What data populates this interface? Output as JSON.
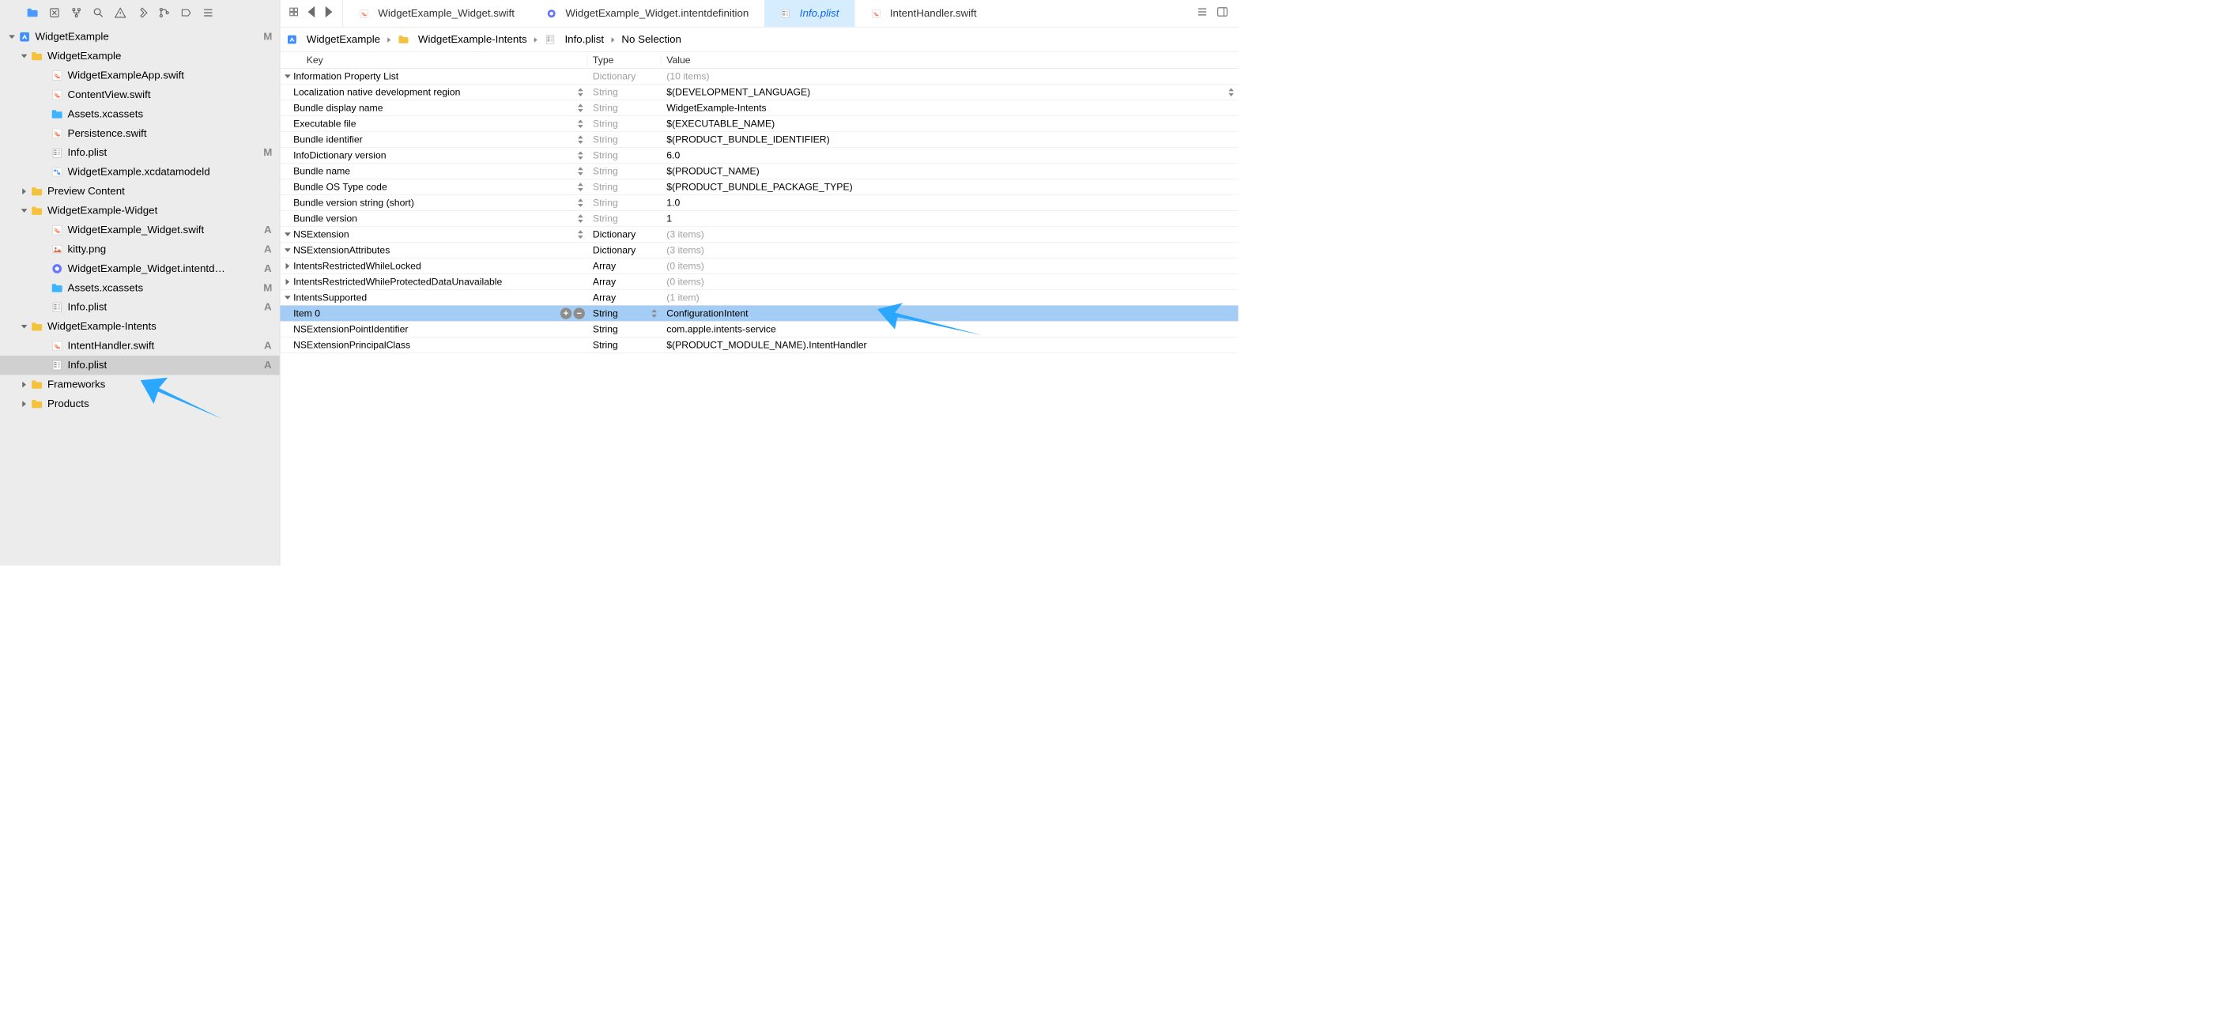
{
  "tabs": {
    "items": [
      {
        "label": "WidgetExample_Widget.swift",
        "icon": "swift",
        "active": false
      },
      {
        "label": "WidgetExample_Widget.intentdefinition",
        "icon": "intent",
        "active": false
      },
      {
        "label": "Info.plist",
        "icon": "plist",
        "active": true
      },
      {
        "label": "IntentHandler.swift",
        "icon": "swift",
        "active": false
      }
    ]
  },
  "path": {
    "segments": [
      {
        "label": "WidgetExample",
        "icon": "proj"
      },
      {
        "label": "WidgetExample-Intents",
        "icon": "folder"
      },
      {
        "label": "Info.plist",
        "icon": "plist"
      },
      {
        "label": "No Selection"
      }
    ]
  },
  "navigator": {
    "tree": [
      {
        "lvl": 0,
        "chev": "down",
        "icon": "proj",
        "label": "WidgetExample",
        "status": "M"
      },
      {
        "lvl": 1,
        "chev": "down",
        "icon": "folder",
        "label": "WidgetExample"
      },
      {
        "lvl": 2,
        "icon": "swift",
        "label": "WidgetExampleApp.swift"
      },
      {
        "lvl": 2,
        "icon": "swift",
        "label": "ContentView.swift"
      },
      {
        "lvl": 2,
        "icon": "asset",
        "label": "Assets.xcassets"
      },
      {
        "lvl": 2,
        "icon": "swift",
        "label": "Persistence.swift"
      },
      {
        "lvl": 2,
        "icon": "plist",
        "label": "Info.plist",
        "status": "M"
      },
      {
        "lvl": 2,
        "icon": "model",
        "label": "WidgetExample.xcdatamodeld"
      },
      {
        "lvl": 1,
        "chev": "right",
        "icon": "folder",
        "label": "Preview Content"
      },
      {
        "lvl": 1,
        "chev": "down",
        "icon": "folder",
        "label": "WidgetExample-Widget"
      },
      {
        "lvl": 2,
        "icon": "swift",
        "label": "WidgetExample_Widget.swift",
        "status": "A"
      },
      {
        "lvl": 2,
        "icon": "img",
        "label": "kitty.png",
        "status": "A"
      },
      {
        "lvl": 2,
        "icon": "intent",
        "label": "WidgetExample_Widget.intentd…",
        "status": "A"
      },
      {
        "lvl": 2,
        "icon": "asset",
        "label": "Assets.xcassets",
        "status": "M"
      },
      {
        "lvl": 2,
        "icon": "plist",
        "label": "Info.plist",
        "status": "A"
      },
      {
        "lvl": 1,
        "chev": "down",
        "icon": "folder",
        "label": "WidgetExample-Intents"
      },
      {
        "lvl": 2,
        "icon": "swift",
        "label": "IntentHandler.swift",
        "status": "A"
      },
      {
        "lvl": 2,
        "icon": "plist",
        "label": "Info.plist",
        "status": "A",
        "selected": true
      },
      {
        "lvl": 1,
        "chev": "right",
        "icon": "folder",
        "label": "Frameworks"
      },
      {
        "lvl": 1,
        "chev": "right",
        "icon": "folder",
        "label": "Products"
      }
    ]
  },
  "plist": {
    "header": {
      "key": "Key",
      "type": "Type",
      "value": "Value"
    },
    "rows": [
      {
        "k": 0,
        "chev": "down",
        "key": "Information Property List",
        "type": "Dictionary",
        "type_muted": true,
        "value": "(10 items)",
        "value_muted": true
      },
      {
        "k": 1,
        "key": "Localization native development region",
        "stepper": true,
        "type": "String",
        "type_muted": true,
        "value": "$(DEVELOPMENT_LANGUAGE)",
        "valstep": true
      },
      {
        "k": 1,
        "key": "Bundle display name",
        "stepper": true,
        "type": "String",
        "type_muted": true,
        "value": "WidgetExample-Intents"
      },
      {
        "k": 1,
        "key": "Executable file",
        "stepper": true,
        "type": "String",
        "type_muted": true,
        "value": "$(EXECUTABLE_NAME)"
      },
      {
        "k": 1,
        "key": "Bundle identifier",
        "stepper": true,
        "type": "String",
        "type_muted": true,
        "value": "$(PRODUCT_BUNDLE_IDENTIFIER)"
      },
      {
        "k": 1,
        "key": "InfoDictionary version",
        "stepper": true,
        "type": "String",
        "type_muted": true,
        "value": "6.0"
      },
      {
        "k": 1,
        "key": "Bundle name",
        "stepper": true,
        "type": "String",
        "type_muted": true,
        "value": "$(PRODUCT_NAME)"
      },
      {
        "k": 1,
        "key": "Bundle OS Type code",
        "stepper": true,
        "type": "String",
        "type_muted": true,
        "value": "$(PRODUCT_BUNDLE_PACKAGE_TYPE)"
      },
      {
        "k": 1,
        "key": "Bundle version string (short)",
        "stepper": true,
        "type": "String",
        "type_muted": true,
        "value": "1.0"
      },
      {
        "k": 1,
        "key": "Bundle version",
        "stepper": true,
        "type": "String",
        "type_muted": true,
        "value": "1"
      },
      {
        "k": 1,
        "chev": "down",
        "key": "NSExtension",
        "stepper": true,
        "type": "Dictionary",
        "value": "(3 items)",
        "value_muted": true
      },
      {
        "k": 2,
        "chev": "down",
        "key": "NSExtensionAttributes",
        "type": "Dictionary",
        "value": "(3 items)",
        "value_muted": true
      },
      {
        "k": 3,
        "chev": "right",
        "key": "IntentsRestrictedWhileLocked",
        "type": "Array",
        "value": "(0 items)",
        "value_muted": true
      },
      {
        "k": 3,
        "chev": "right",
        "key": "IntentsRestrictedWhileProtectedDataUnavailable",
        "type": "Array",
        "value": "(0 items)",
        "value_muted": true
      },
      {
        "k": 3,
        "chev": "down",
        "key": "IntentsSupported",
        "type": "Array",
        "value": "(1 item)",
        "value_muted": true
      },
      {
        "k": 4,
        "key": "Item 0",
        "addrm": true,
        "type": "String",
        "type_stepper": true,
        "value": "ConfigurationIntent",
        "selected": true
      },
      {
        "k": 2,
        "key": "NSExtensionPointIdentifier",
        "type": "String",
        "value": "com.apple.intents-service"
      },
      {
        "k": 2,
        "key": "NSExtensionPrincipalClass",
        "type": "String",
        "value": "$(PRODUCT_MODULE_NAME).IntentHandler"
      }
    ]
  }
}
